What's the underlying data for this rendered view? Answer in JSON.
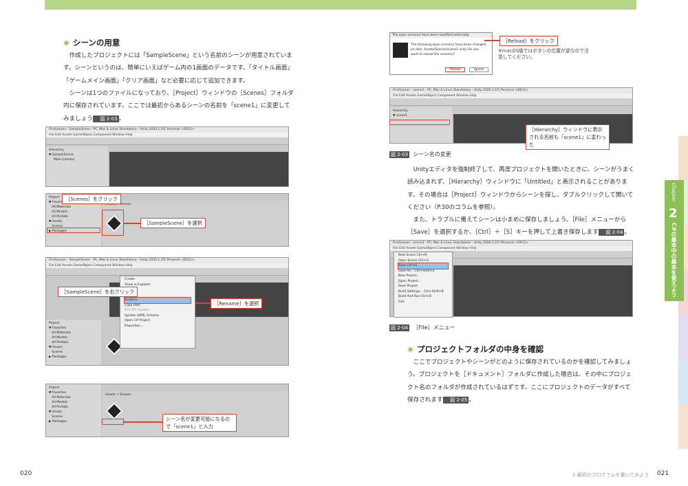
{
  "left": {
    "heading": "シーンの用意",
    "paragraph": "作成したプロジェクトには「SampleScene」という名前のシーンが用意されています。シーンというのは、簡単にいえばゲーム内の1画面のデータです。「タイトル画面」「ゲームメイン画面」「クリア画面」など必要に応じて追加できます。",
    "paragraph2": "シーンは1つのファイルになっており、［Project］ウィンドウの［Scenes］フォルダ内に保存されています。ここでは最初からあるシーンの名前を「scene1」に変更してみましょう",
    "fig_ref": "図 2-03",
    "shot1_title": "FirstLesson - SampleScene - PC, Mac & Linux Standalone - Unity 2020.1.1f1 Personal <DX11>",
    "menu": "File   Edit   Assets   GameObject   Component   Window   Help",
    "shot1_panel": "Hierarchy\n▼ SampleScene\n     Main Camera",
    "shot2_panel": "Project\n▼ Favorites\n   All Materials\n   All Models\n   All Prefabs\n▼ Assets\n   Scenes\n▶ Packages",
    "shot2_path": "Assets > Scenes",
    "callout_scenes": "［Scenes］をクリック",
    "callout_sample": "［SampleScene］を選択",
    "callout_rightclick": "［SampleScene］を右クリック",
    "callout_rename": "［Rename］を選択",
    "context_menu": [
      "Create",
      "Show in Explorer",
      "Open",
      "Delete",
      "Rename",
      "Copy Path",
      "Run API Updater...",
      "Update UXML Schema",
      "Open C# Project",
      "Properties..."
    ],
    "callout_enter": "シーン名が変更可能になるので「scene1」と入力",
    "page": "020"
  },
  "right": {
    "dialog_title": "The open scene(s) have been modified externally.",
    "dialog_text": "The following open scene(s) have been changed on disk: Assets/Scenes/scene1.unity  Do you want to reload the scene(s)?",
    "reload": "Reload",
    "ignore": "Ignore",
    "callout_reload": "［Reload］をクリック",
    "note": "※macOS版ではボタンの位置が逆なので注意してください。",
    "shot_title": "FirstLesson - scene1 - PC, Mac & Linux Standalone - Unity 2020.1.1f1 Personal <DX11>",
    "hier_item": "scene1",
    "callout_hier": "［Hierarchy］ウィンドウに表示される名前も「scene1」に変わった",
    "caption1_num": "図 2-03",
    "caption1": "シーン名の変更",
    "para1": "Unityエディタを強制終了して、再度プロジェクトを開いたときに、シーンがうまく読み込まれず、［Hierarchy］ウィンドウに「Untitled」と表示されることがあります。その場合は［Project］ウィンドウからシーンを探し、ダブルクリックして開いてください（P.30のコラムを参照）。",
    "para2": "また、トラブルに備えてシーンは小まめに保存しましょう。［File］メニューから［Save］を選択するか、［Ctrl］＋［S］キーを押して上書き保存します",
    "fig_ref2": "図 2-04",
    "file_menu": [
      "New Scene   Ctrl+N",
      "Open Scene   Ctrl+O",
      "Save   Ctrl+S",
      "Save As...   Ctrl+Shift+S",
      "New Project...",
      "Open Project...",
      "Save Project",
      "Build Settings...   Ctrl+Shift+B",
      "Build And Run   Ctrl+B",
      "Exit"
    ],
    "caption2_num": "図 2-04",
    "caption2": "［File］メニュー",
    "heading2": "プロジェクトフォルダの中身を確認",
    "para3": "ここでプロジェクトやシーンがどのように保存されているのかを確認してみましょう。プロジェクトを［ドキュメント］フォルダに作成した場合は、その中にプロジェクト名のフォルダが作成されているはずです。ここにプロジェクトのデータがすべて保存されます",
    "fig_ref3": "図 2-05",
    "footer": "1 最初のプログラムを書いてみよう",
    "page": "021"
  },
  "chapter": {
    "label": "Chapter",
    "num": "2",
    "title": "C#の基本中の基本を覚えよう"
  },
  "tab_colors": [
    "#f4dfcb",
    "#e6f0d8",
    "#f7e4c8",
    "#f3d6dc",
    "#e4dcef",
    "#d7e7f3",
    "#f3e2d2"
  ]
}
